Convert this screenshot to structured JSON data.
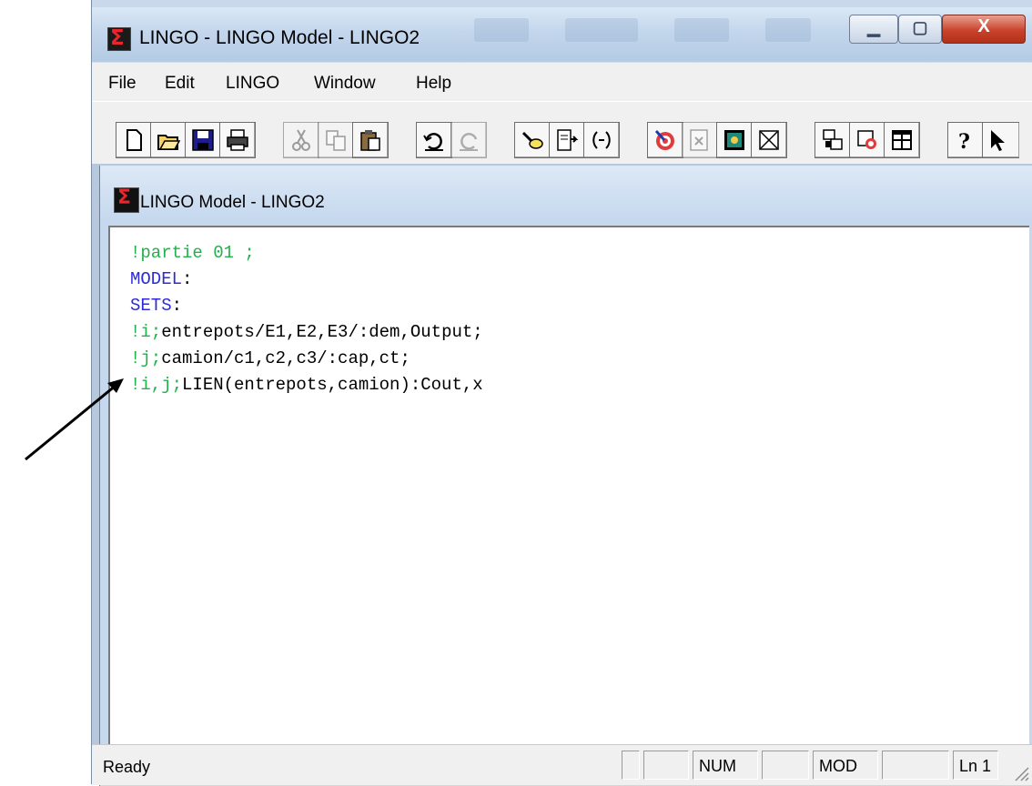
{
  "window": {
    "title": "LINGO - LINGO Model - LINGO2",
    "controls": {
      "minimize": "▁",
      "maximize": "▢",
      "close": "X"
    }
  },
  "menu": [
    "File",
    "Edit",
    "LINGO",
    "Window",
    "Help"
  ],
  "toolbar": {
    "buttons": [
      {
        "name": "new-file-icon"
      },
      {
        "name": "open-folder-icon"
      },
      {
        "name": "save-disk-icon"
      },
      {
        "name": "print-icon"
      },
      {
        "name": "cut-icon"
      },
      {
        "name": "copy-icon"
      },
      {
        "name": "paste-icon"
      },
      {
        "name": "undo-icon"
      },
      {
        "name": "redo-icon"
      },
      {
        "name": "find-icon"
      },
      {
        "name": "go-to-line-icon"
      },
      {
        "name": "match-parenthesis-icon"
      },
      {
        "name": "solve-target-icon"
      },
      {
        "name": "solution-report-icon"
      },
      {
        "name": "picture-icon"
      },
      {
        "name": "close-all-icon"
      },
      {
        "name": "send-to-back-icon"
      },
      {
        "name": "options-icon"
      },
      {
        "name": "tile-icon"
      },
      {
        "name": "help-icon"
      }
    ]
  },
  "child_window": {
    "title": "LINGO Model - LINGO2"
  },
  "colors": {
    "comment": "#22b14c",
    "keyword": "#2b2bd8",
    "text": "#000000"
  },
  "editor": {
    "lines": [
      [
        {
          "t": "!partie 01 ;",
          "c": "comment"
        }
      ],
      [
        {
          "t": "MODEL",
          "c": "keyword"
        },
        {
          "t": ":",
          "c": "text"
        }
      ],
      [
        {
          "t": "SETS",
          "c": "keyword"
        },
        {
          "t": ":",
          "c": "text"
        }
      ],
      [
        {
          "t": "!i;",
          "c": "comment"
        },
        {
          "t": "entrepots/E1,E2,E3/:dem,Output;",
          "c": "text"
        }
      ],
      [
        {
          "t": "!j;",
          "c": "comment"
        },
        {
          "t": "camion/c1,c2,c3/:cap,ct;",
          "c": "text"
        }
      ],
      [
        {
          "t": "!i,j;",
          "c": "comment"
        },
        {
          "t": "LIEN(entrepots,camion):Cout,x",
          "c": "text"
        }
      ]
    ]
  },
  "status": {
    "ready": "Ready",
    "num": "NUM",
    "mod": "MOD",
    "ln": "Ln 1"
  }
}
